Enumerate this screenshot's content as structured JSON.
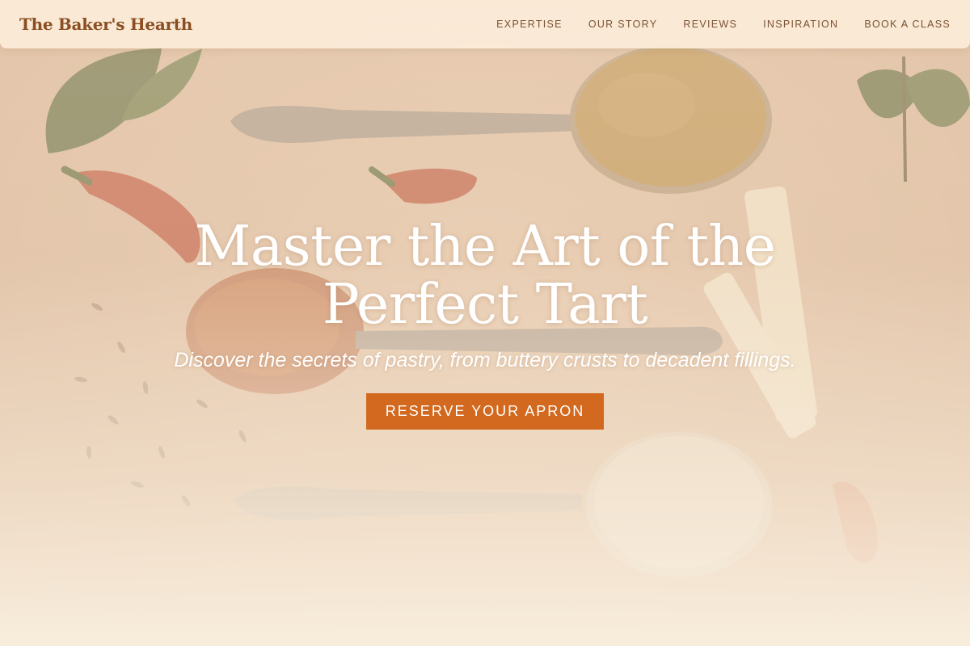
{
  "header": {
    "brand": "The Baker's Hearth",
    "nav": [
      {
        "label": "EXPERTISE"
      },
      {
        "label": "OUR STORY"
      },
      {
        "label": "REVIEWS"
      },
      {
        "label": "INSPIRATION"
      },
      {
        "label": "BOOK A CLASS"
      }
    ]
  },
  "hero": {
    "title": "Master the Art of the Perfect Tart",
    "subtitle": "Discover the secrets of pastry, from buttery crusts to decadent fillings.",
    "cta_label": "RESERVE YOUR APRON"
  },
  "colors": {
    "brand": "#8a4e22",
    "accent": "#d2691e",
    "header_bg": "#fbecd8",
    "nav_text": "#7a5234",
    "hero_text": "#ffffff"
  }
}
